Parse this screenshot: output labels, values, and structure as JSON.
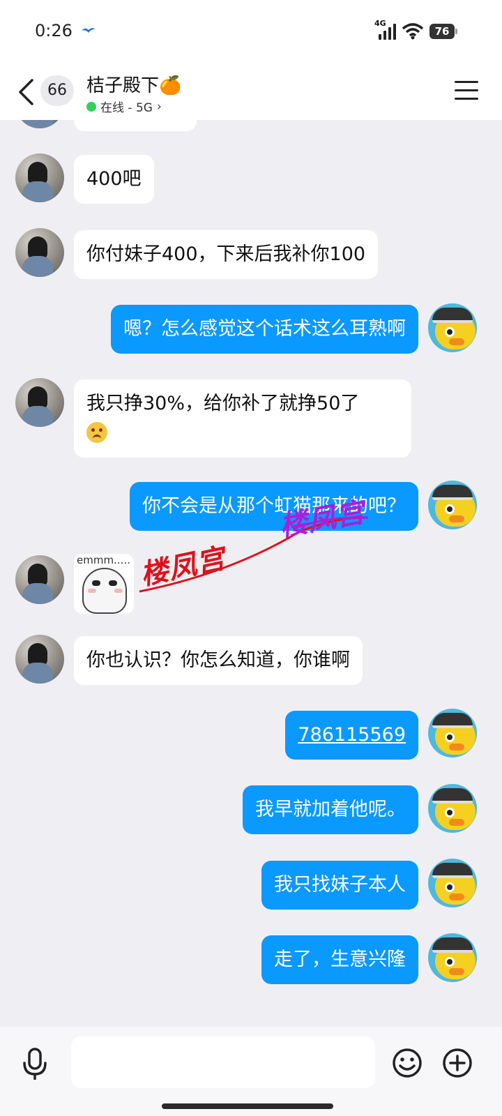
{
  "status_bar": {
    "time": "0:26",
    "network_label": "4G",
    "battery_level": "76"
  },
  "header": {
    "unread_count": "66",
    "contact_name": "桔子殿下🍊",
    "status_text": "在线 - 5G",
    "status_chevron": "›"
  },
  "messages": [
    {
      "side": "in",
      "text": "400吧"
    },
    {
      "side": "in",
      "text": "你付妹子400，下来后我补你100"
    },
    {
      "side": "out",
      "text": "嗯？怎么感觉这个话术这么耳熟啊"
    },
    {
      "side": "in",
      "text_line1": "我只挣30%，给你补了就挣50了"
    },
    {
      "side": "out",
      "text": "你不会是从那个虹猫那来的吧？"
    },
    {
      "side": "in",
      "sticker_text": "emmm....."
    },
    {
      "side": "in",
      "text": "你也认识？你怎么知道，你谁啊"
    },
    {
      "side": "out",
      "text": "786115569",
      "link": true
    },
    {
      "side": "out",
      "text": "我早就加着他呢。"
    },
    {
      "side": "out",
      "text": "我只找妹子本人"
    },
    {
      "side": "out",
      "text": "走了，生意兴隆"
    }
  ],
  "watermarks": [
    "楼凤宫",
    "楼凤宫"
  ],
  "input": {
    "placeholder": ""
  },
  "colors": {
    "outgoing_bubble": "#0a99ff",
    "incoming_bubble": "#ffffff",
    "background": "#efeff3",
    "online_dot": "#2fd35c"
  },
  "icons": [
    "back-icon",
    "menu-icon",
    "mic-icon",
    "emoji-icon",
    "plus-icon"
  ]
}
